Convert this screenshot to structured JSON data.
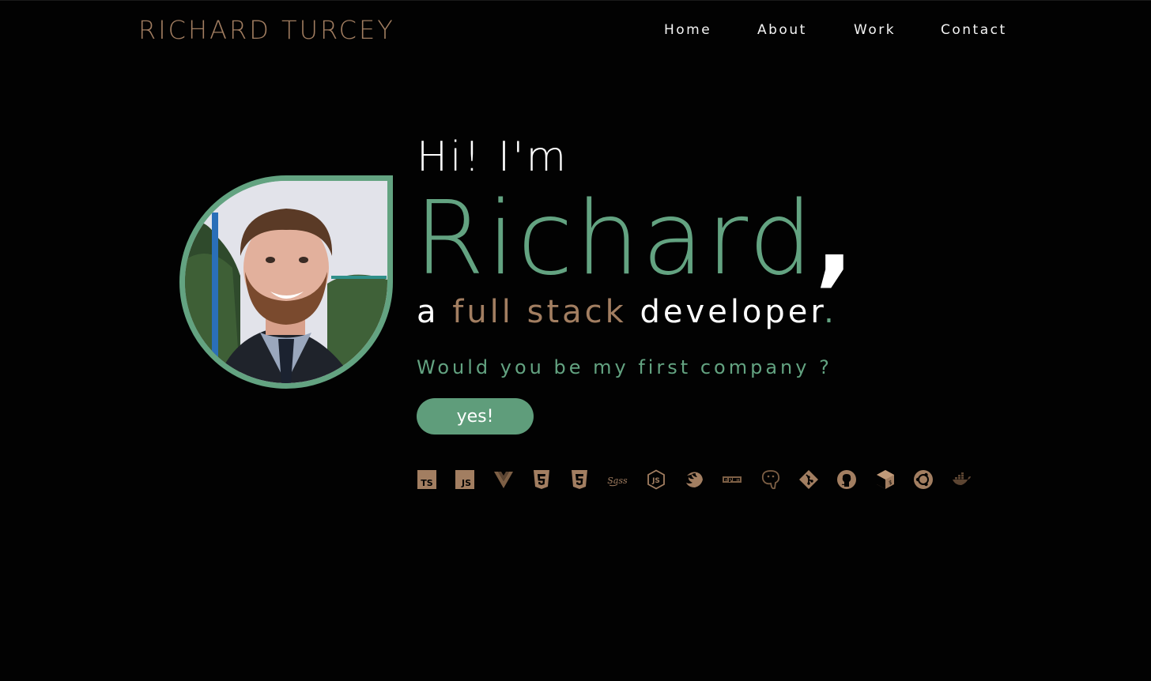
{
  "header": {
    "brand": "RICHARD TURCEY",
    "nav": [
      "Home",
      "About",
      "Work",
      "Contact"
    ]
  },
  "hero": {
    "greeting": "Hi! I'm",
    "name": "Richard",
    "name_suffix": ",",
    "role_prefix": "a",
    "role_highlight": "full stack",
    "role_rest": "developer",
    "role_end": ".",
    "question": "Would you be my first company ?",
    "cta_label": "yes!"
  },
  "tech_icons": [
    "typescript-icon",
    "javascript-icon",
    "vue-icon",
    "html5-icon",
    "css3-icon",
    "sass-icon",
    "nodejs-icon",
    "nestjs-icon",
    "npm-icon",
    "postgresql-icon",
    "git-icon",
    "github-icon",
    "bootstrap-icon",
    "ubuntu-icon",
    "docker-icon"
  ],
  "colors": {
    "background": "#020202",
    "brand": "#a27e61",
    "accent_green": "#63a381",
    "button": "#5f9d7b",
    "text": "#ffffff"
  }
}
